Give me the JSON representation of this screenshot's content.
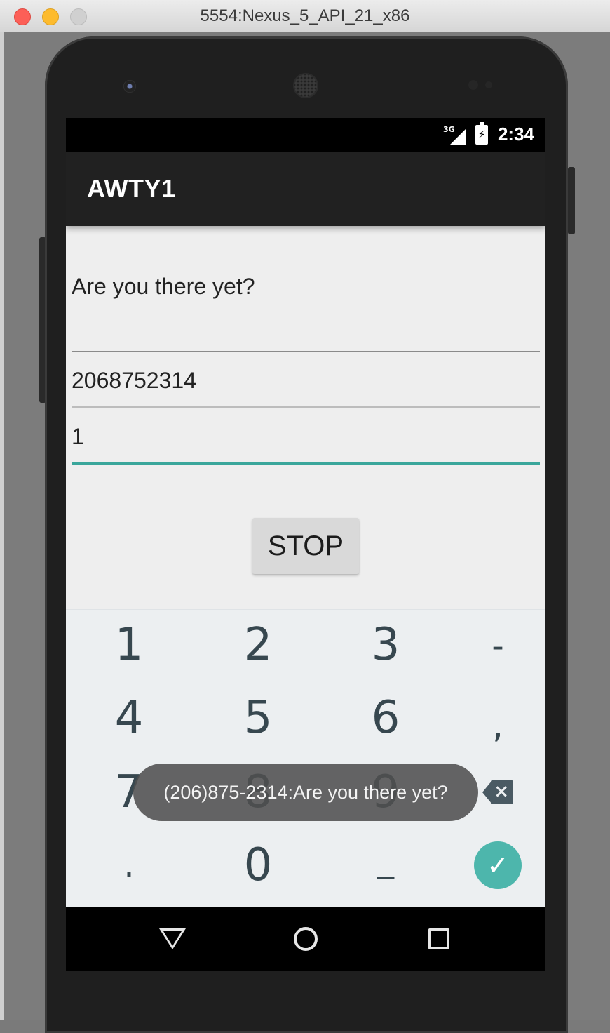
{
  "window": {
    "title": "5554:Nexus_5_API_21_x86"
  },
  "status_bar": {
    "network": "3G",
    "time": "2:34"
  },
  "app_bar": {
    "title": "AWTY1"
  },
  "form": {
    "message_value": "Are you there yet?",
    "phone_value": "2068752314",
    "minutes_value": "1",
    "stop_label": "STOP"
  },
  "keyboard": {
    "rows": [
      [
        "1",
        "2",
        "3",
        "-"
      ],
      [
        "4",
        "5",
        "6",
        ","
      ],
      [
        "7",
        "8",
        "9",
        "backspace-icon"
      ],
      [
        ".",
        "0",
        "_",
        "check-icon"
      ]
    ]
  },
  "toast": {
    "text": "(206)875-2314:Are you there yet?"
  },
  "nav_bar": {
    "icons": [
      "back-icon",
      "home-icon",
      "recents-icon"
    ]
  },
  "colors": {
    "accent": "#4db6ac",
    "appbar": "#212121",
    "screen_bg": "#eeeeee",
    "keyboard_bg": "#eceff1"
  }
}
